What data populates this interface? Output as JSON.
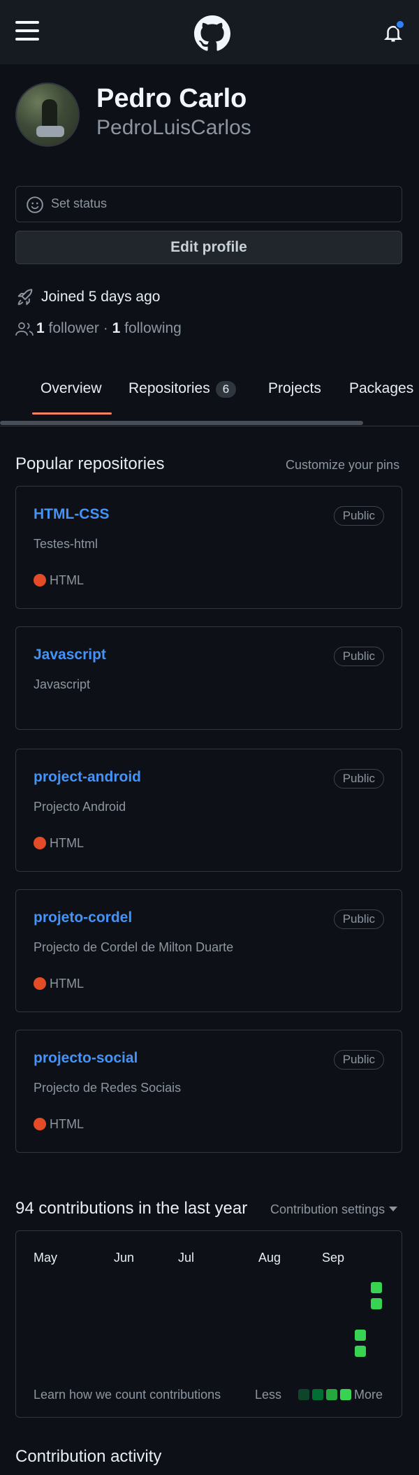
{
  "profile": {
    "name": "Pedro Carlo",
    "login": "PedroLuisCarlos",
    "status_label": "Set status",
    "edit_label": "Edit profile",
    "joined": "Joined 5 days ago",
    "followers_count": "1",
    "followers_label": "follower",
    "following_count": "1",
    "following_label": "following",
    "separator": "·"
  },
  "tabs": {
    "overview": "Overview",
    "repositories": "Repositories",
    "repositories_count": "6",
    "projects": "Projects",
    "packages": "Packages"
  },
  "popular": {
    "title": "Popular repositories",
    "customize": "Customize your pins",
    "repos": [
      {
        "name": "HTML-CSS",
        "visibility": "Public",
        "description": "Testes-html",
        "language": "HTML"
      },
      {
        "name": "Javascript",
        "visibility": "Public",
        "description": "Javascript",
        "language": ""
      },
      {
        "name": "project-android",
        "visibility": "Public",
        "description": "Projecto Android",
        "language": "HTML"
      },
      {
        "name": "projeto-cordel",
        "visibility": "Public",
        "description": "Projecto de Cordel de Milton Duarte",
        "language": "HTML"
      },
      {
        "name": "projecto-social",
        "visibility": "Public",
        "description": "Projecto de Redes Sociais",
        "language": "HTML"
      }
    ]
  },
  "contributions": {
    "title": "94 contributions in the last year",
    "settings": "Contribution settings",
    "months": [
      "May",
      "Jun",
      "Jul",
      "Aug",
      "Sep"
    ],
    "learn": "Learn how we count contributions",
    "less": "Less",
    "more": "More"
  },
  "activity": {
    "title": "Contribution activity"
  },
  "colors": {
    "accent_link": "#4493f8",
    "html_language": "#e34c26",
    "contribution_level_4": "#39d353",
    "active_tab": "#f78166",
    "notification_dot": "#2f81f7"
  }
}
